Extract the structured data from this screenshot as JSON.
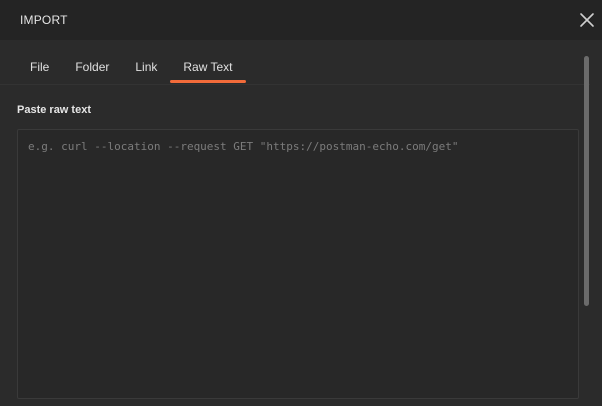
{
  "dialog": {
    "title": "IMPORT",
    "close_icon": "close-icon"
  },
  "tabs": [
    {
      "label": "File",
      "active": false
    },
    {
      "label": "Folder",
      "active": false
    },
    {
      "label": "Link",
      "active": false
    },
    {
      "label": "Raw Text",
      "active": true
    }
  ],
  "raw_text": {
    "label": "Paste raw text",
    "value": "",
    "placeholder": "e.g. curl --location --request GET \"https://postman-echo.com/get\""
  },
  "colors": {
    "accent": "#f26b3a",
    "background": "#2b2b2b",
    "header": "#242424"
  }
}
